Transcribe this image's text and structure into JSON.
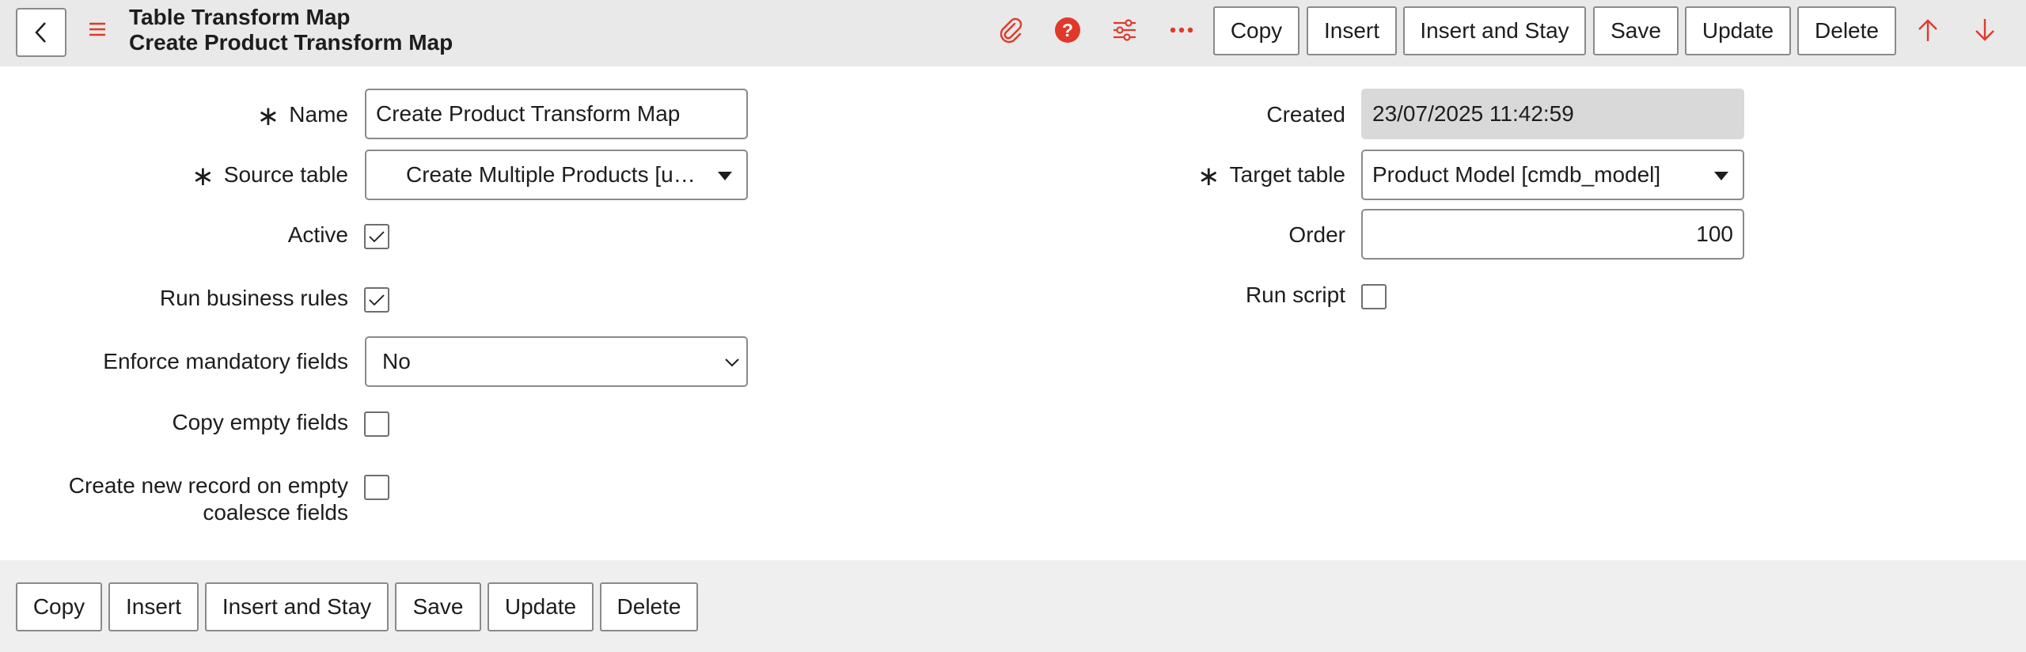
{
  "header": {
    "title": "Table Transform Map",
    "subtitle": "Create Product Transform Map",
    "buttons": {
      "copy": "Copy",
      "insert": "Insert",
      "insert_and_stay": "Insert and Stay",
      "save": "Save",
      "update": "Update",
      "delete": "Delete"
    },
    "icons": [
      "back-icon",
      "menu-icon",
      "paperclip-icon",
      "help-icon",
      "settings-sliders-icon",
      "more-icon",
      "arrow-up-icon",
      "arrow-down-icon"
    ],
    "accent_color": "#e0392b"
  },
  "form": {
    "name": {
      "label": "Name",
      "value": "Create Product Transform Map",
      "required": true
    },
    "source_table": {
      "label": "Source table",
      "value": "Create Multiple Products [u…",
      "required": true
    },
    "active": {
      "label": "Active",
      "checked": true
    },
    "run_business_rules": {
      "label": "Run business rules",
      "checked": true
    },
    "enforce_mandatory_fields": {
      "label": "Enforce mandatory fields",
      "value": "No"
    },
    "copy_empty_fields": {
      "label": "Copy empty fields",
      "checked": false
    },
    "create_new_record": {
      "label_line1": "Create new record on empty",
      "label_line2": "coalesce fields",
      "checked": false
    },
    "created": {
      "label": "Created",
      "value": "23/07/2025 11:42:59"
    },
    "target_table": {
      "label": "Target table",
      "value": "Product Model [cmdb_model]",
      "required": true
    },
    "order": {
      "label": "Order",
      "value": "100"
    },
    "run_script": {
      "label": "Run script",
      "checked": false
    }
  },
  "footer": {
    "buttons": {
      "copy": "Copy",
      "insert": "Insert",
      "insert_and_stay": "Insert and Stay",
      "save": "Save",
      "update": "Update",
      "delete": "Delete"
    }
  }
}
